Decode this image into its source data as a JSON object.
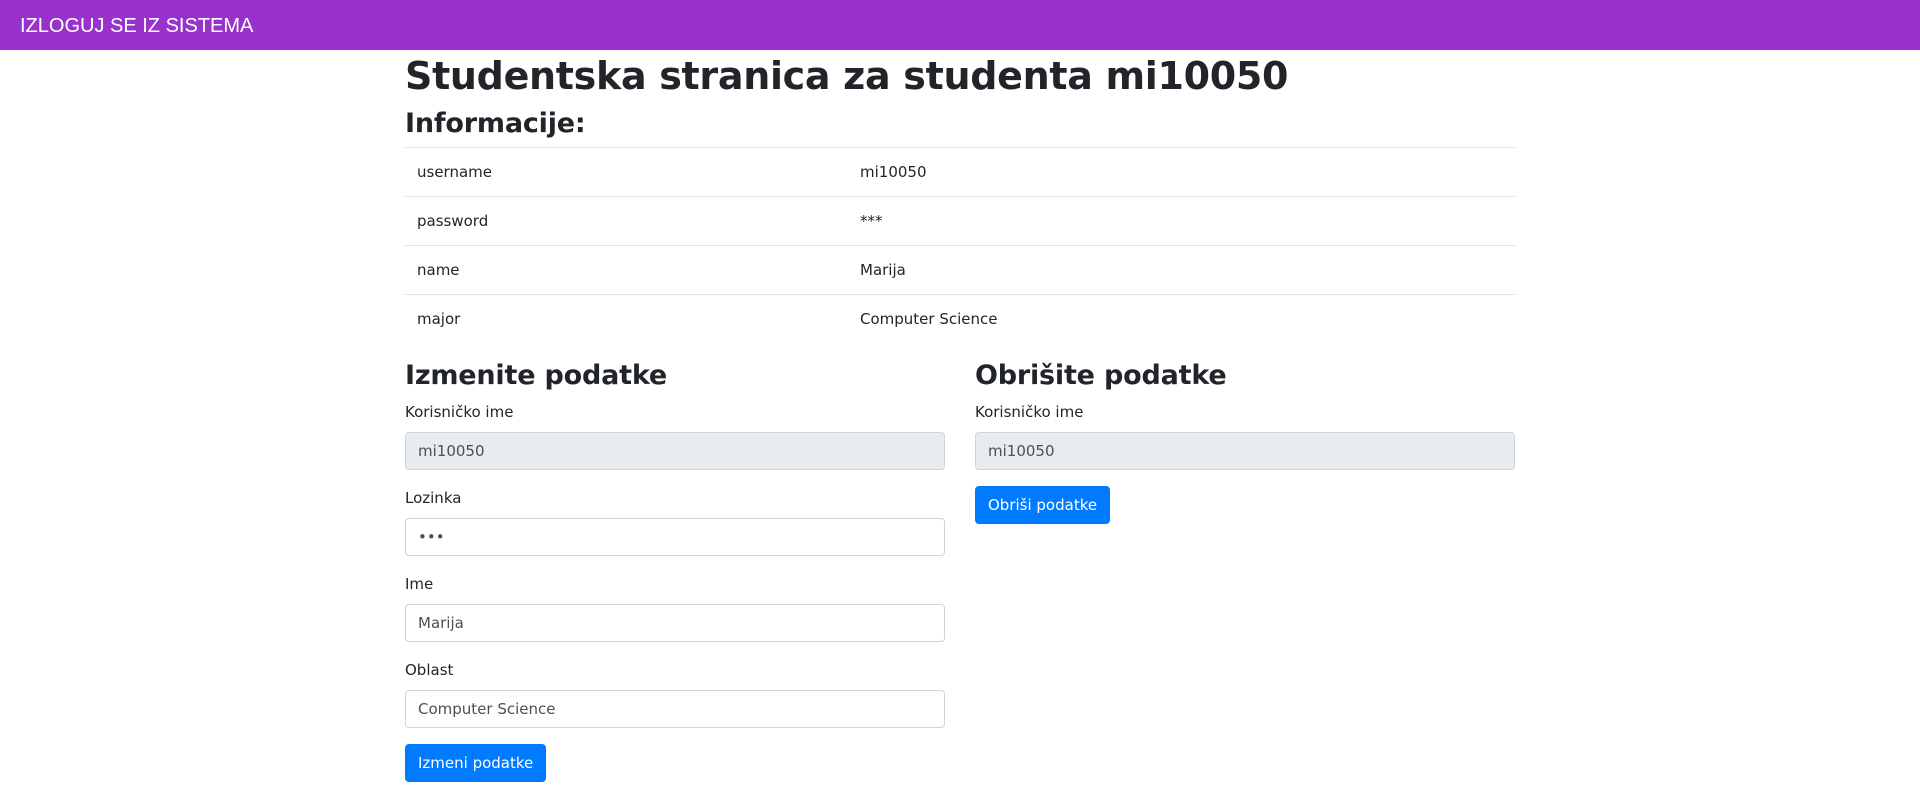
{
  "navbar": {
    "logout_label": "IZLOGUJ SE IZ SISTEMA"
  },
  "page": {
    "title": "Studentska stranica za studenta mi10050"
  },
  "info": {
    "title": "Informacije:",
    "rows": [
      {
        "key": "username",
        "value": "mi10050"
      },
      {
        "key": "password",
        "value": "***"
      },
      {
        "key": "name",
        "value": "Marija"
      },
      {
        "key": "major",
        "value": "Computer Science"
      }
    ]
  },
  "edit_form": {
    "title": "Izmenite podatke",
    "username_label": "Korisničko ime",
    "username_value": "mi10050",
    "password_label": "Lozinka",
    "password_value": "***",
    "name_label": "Ime",
    "name_value": "Marija",
    "major_label": "Oblast",
    "major_value": "Computer Science",
    "submit_label": "Izmeni podatke"
  },
  "delete_form": {
    "title": "Obrišite podatke",
    "username_label": "Korisničko ime",
    "username_value": "mi10050",
    "submit_label": "Obriši podatke"
  },
  "colors": {
    "navbar": "#9932cc",
    "primary_button": "#007bff",
    "readonly_input": "#e9ecef"
  }
}
